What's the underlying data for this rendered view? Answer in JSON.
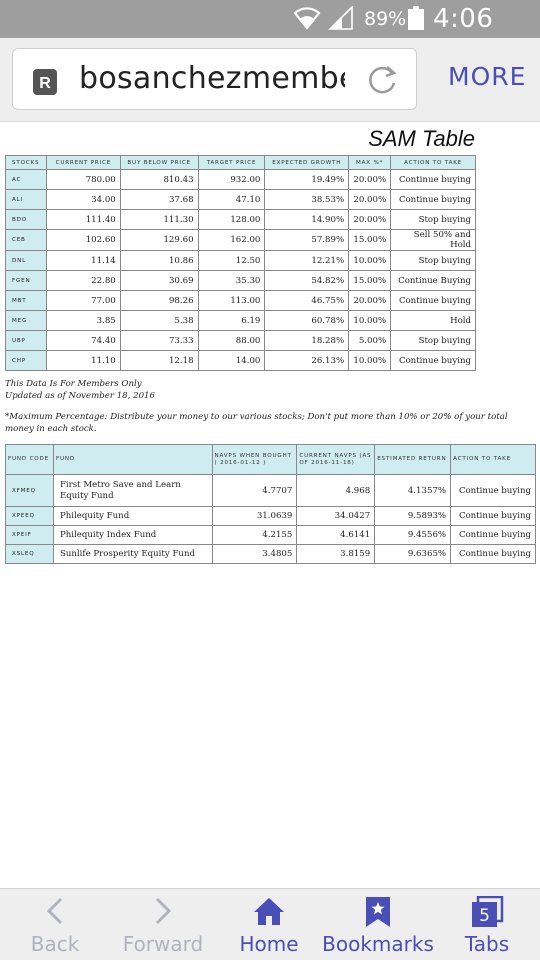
{
  "status_bar": {
    "battery_percent": "89%",
    "time": "4:06 PM"
  },
  "browser": {
    "url": "bosanchezmembe",
    "site_icon_letter": "R",
    "more_label": "MORE"
  },
  "page": {
    "title": "SAM Table",
    "stocks_table": {
      "headers": [
        "STOCKS",
        "CURRENT PRICE",
        "BUY BELOW PRICE",
        "TARGET PRICE",
        "EXPECTED GROWTH",
        "MAX %*",
        "ACTION TO TAKE"
      ],
      "rows": [
        [
          "AC",
          "780.00",
          "810.43",
          "932.00",
          "19.49%",
          "20.00%",
          "Continue buying"
        ],
        [
          "ALI",
          "34.00",
          "37.68",
          "47.10",
          "38.53%",
          "20.00%",
          "Continue buying"
        ],
        [
          "BDO",
          "111.40",
          "111.30",
          "128.00",
          "14.90%",
          "20.00%",
          "Stop buying"
        ],
        [
          "CEB",
          "102.60",
          "129.60",
          "162.00",
          "57.89%",
          "15.00%",
          "Sell 50% and Hold"
        ],
        [
          "DNL",
          "11.14",
          "10.86",
          "12.50",
          "12.21%",
          "10.00%",
          "Stop buying"
        ],
        [
          "FGEN",
          "22.80",
          "30.69",
          "35.30",
          "54.82%",
          "15.00%",
          "Continue Buying"
        ],
        [
          "MBT",
          "77.00",
          "98.26",
          "113.00",
          "46.75%",
          "20.00%",
          "Continue buying"
        ],
        [
          "MEG",
          "3.85",
          "5.38",
          "6.19",
          "60.78%",
          "10.00%",
          "Hold"
        ],
        [
          "UBP",
          "74.40",
          "73.33",
          "88.00",
          "18.28%",
          "5.00%",
          "Stop buying"
        ],
        [
          "CHP",
          "11.10",
          "12.18",
          "14.00",
          "26.13%",
          "10.00%",
          "Continue buying"
        ]
      ]
    },
    "members_note": "This Data Is For Members Only",
    "updated_note": "Updated as of November 18, 2016",
    "max_note": "*Maximum Percentage: Distribute your money to our various stocks; Don't put more than 10% or 20% of your total money in each stock.",
    "funds_table": {
      "headers": [
        "FUND CODE",
        "FUND",
        "NAVPS WHEN BOUGHT ( 2016-01-12 )",
        "CURRENT NAVPS (AS OF 2016-11-18)",
        "ESTIMATED RETURN",
        "ACTION TO TAKE"
      ],
      "rows": [
        [
          "XFMEQ",
          "First Metro Save and Learn Equity Fund",
          "4.7707",
          "4.968",
          "4.1357%",
          "Continue buying"
        ],
        [
          "XPEEQ",
          "Philequity Fund",
          "31.0639",
          "34.0427",
          "9.5893%",
          "Continue buying"
        ],
        [
          "XPEIF",
          "Philequity Index Fund",
          "4.2155",
          "4.6141",
          "9.4556%",
          "Continue buying"
        ],
        [
          "XSLEQ",
          "Sunlife Prosperity Equity Fund",
          "3.4805",
          "3.8159",
          "9.6365%",
          "Continue buying"
        ]
      ]
    }
  },
  "bottom_nav": {
    "back": "Back",
    "forward": "Forward",
    "home": "Home",
    "bookmarks": "Bookmarks",
    "tabs": "Tabs",
    "tabs_count": "5"
  },
  "colors": {
    "accent": "#4a4fb8",
    "header_cell": "#cfecf0",
    "status_bar": "#9e9e9e",
    "disabled": "#b0b4bf"
  }
}
